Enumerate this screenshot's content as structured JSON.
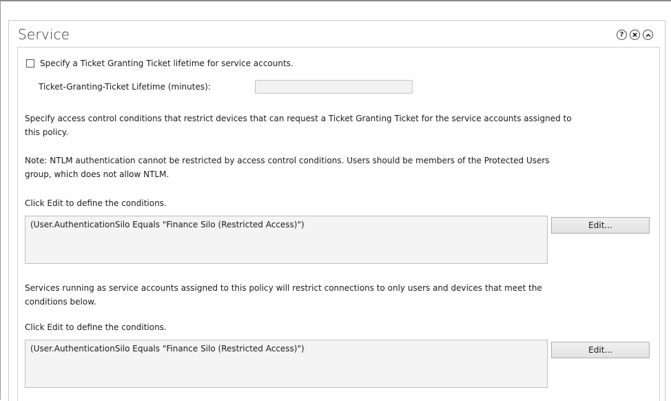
{
  "section": {
    "title": "Service",
    "icons": [
      "help-icon",
      "close-icon",
      "collapse-icon"
    ],
    "help_glyph": "?"
  },
  "tgt": {
    "checkbox_label": "Specify a Ticket Granting Ticket lifetime for service accounts.",
    "checked": false,
    "lifetime_label": "Ticket-Granting-Ticket Lifetime (minutes):",
    "lifetime_value": ""
  },
  "access_control": {
    "description_line1": "Specify access control conditions that restrict devices that can request a Ticket Granting Ticket for the service accounts assigned to",
    "description_line2": "this policy.",
    "note_line1": "Note: NTLM authentication cannot be restricted by access control conditions. Users should be members of the Protected Users",
    "note_line2": "group, which does not allow NTLM.",
    "click_edit": "Click Edit to define the conditions.",
    "condition": "(User.AuthenticationSilo Equals \"Finance Silo (Restricted Access)\")",
    "edit_label": "Edit..."
  },
  "service_connections": {
    "description_line1": "Services running as service accounts assigned to this policy will restrict connections to only users and devices that meet the",
    "description_line2": "conditions below.",
    "click_edit": "Click Edit to define the conditions.",
    "condition": "(User.AuthenticationSilo Equals \"Finance Silo (Restricted Access)\")",
    "edit_label": "Edit..."
  }
}
